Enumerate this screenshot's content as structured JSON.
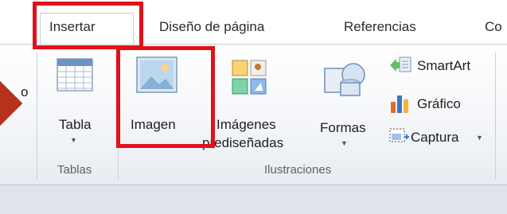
{
  "tabs": {
    "insertar": "Insertar",
    "diseno": "Diseño de página",
    "referencias": "Referencias",
    "partial": "Co"
  },
  "left_fragment": "o",
  "groups": {
    "tablas": {
      "label": "Tablas",
      "tabla_button": "Tabla"
    },
    "ilustraciones": {
      "label": "Ilustraciones",
      "imagen_button": "Imagen",
      "imagenes_button_line1": "Imágenes",
      "imagenes_button_line2": "prediseñadas",
      "formas_button": "Formas",
      "smartart_button": "SmartArt",
      "grafico_button": "Gráfico",
      "captura_button": "Captura"
    }
  },
  "colors": {
    "highlight": "#e2101a",
    "arrow": "#b6321d"
  },
  "icons": {
    "table": "table-icon",
    "picture": "picture-icon",
    "clipart": "clipart-icon",
    "shapes": "shapes-icon",
    "smartart": "smartart-icon",
    "chart": "chart-icon",
    "screenshot": "screenshot-icon",
    "dropdown": "chevron-down-icon"
  }
}
